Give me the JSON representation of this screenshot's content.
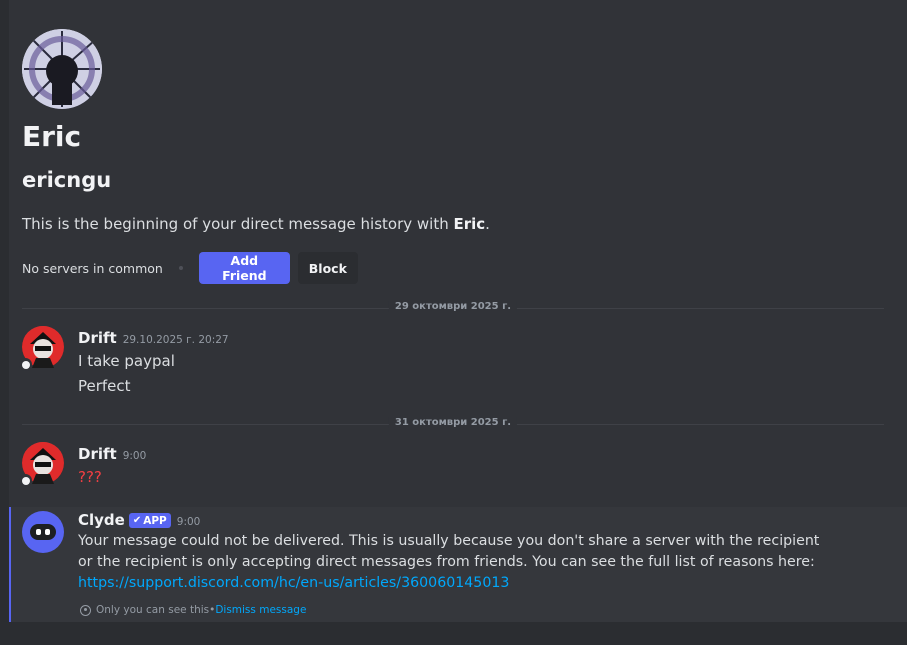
{
  "welcome": {
    "display_name": "Eric",
    "username": "ericngu",
    "desc_prefix": "This is the beginning of your direct message history with ",
    "desc_name": "Eric",
    "desc_suffix": ".",
    "no_servers": "No servers in common",
    "add_friend": "Add Friend",
    "block": "Block"
  },
  "dividers": [
    {
      "label": "29 октомври 2025 г."
    },
    {
      "label": "31 октомври 2025 г."
    }
  ],
  "messages": [
    {
      "author": "Drift",
      "time": "29.10.2025 г. 20:27",
      "lines": [
        "I take paypal",
        "Perfect"
      ]
    },
    {
      "author": "Drift",
      "time": "9:00",
      "lines": [
        "???"
      ]
    }
  ],
  "clyde": {
    "author": "Clyde",
    "tag": "APP",
    "time": "9:00",
    "text": "Your message could not be delivered. This is usually because you don't share a server with the recipient or the recipient is only accepting direct messages from friends. You can see the full list of reasons here: ",
    "link": "https://support.discord.com/hc/en-us/articles/360060145013",
    "only_you": "Only you can see this",
    "sep": " • ",
    "dismiss": "Dismiss message"
  },
  "colors": {
    "background": "#313338",
    "accent": "#5865f2",
    "link": "#00a8fc",
    "danger_text": "#f23f43"
  }
}
